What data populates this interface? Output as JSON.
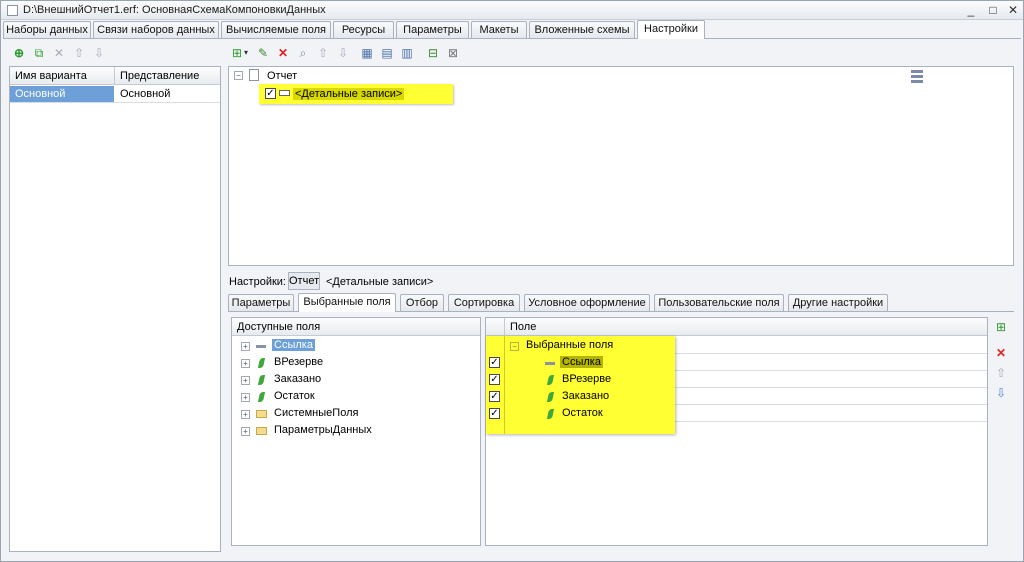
{
  "window": {
    "title": "D:\\ВнешнийОтчет1.erf: ОсновнаяСхемаКомпоновкиДанных",
    "minimize_glyph": "_",
    "maximize_glyph": "□",
    "close_glyph": "✕"
  },
  "top_tabs": [
    {
      "label": "Наборы данных"
    },
    {
      "label": "Связи наборов данных"
    },
    {
      "label": "Вычисляемые поля"
    },
    {
      "label": "Ресурсы"
    },
    {
      "label": "Параметры"
    },
    {
      "label": "Макеты"
    },
    {
      "label": "Вложенные схемы"
    },
    {
      "label": "Настройки"
    }
  ],
  "variants": {
    "columns": [
      "Имя варианта",
      "Представление"
    ],
    "rows": [
      [
        "Основной",
        "Основной"
      ]
    ]
  },
  "structure": {
    "root_label": "Отчет",
    "child_label": "<Детальные записи>"
  },
  "settings_bar": {
    "label": "Настройки:",
    "button": "Отчет",
    "value": "<Детальные записи>"
  },
  "settings_tabs": [
    {
      "label": "Параметры"
    },
    {
      "label": "Выбранные поля"
    },
    {
      "label": "Отбор"
    },
    {
      "label": "Сортировка"
    },
    {
      "label": "Условное оформление"
    },
    {
      "label": "Пользовательские поля"
    },
    {
      "label": "Другие настройки"
    }
  ],
  "available_fields": {
    "header": "Доступные поля",
    "items": [
      {
        "label": "Ссылка",
        "icon": "dash-icon"
      },
      {
        "label": "ВРезерве",
        "icon": "leaf-icon"
      },
      {
        "label": "Заказано",
        "icon": "leaf-icon"
      },
      {
        "label": "Остаток",
        "icon": "leaf-icon"
      },
      {
        "label": "СистемныеПоля",
        "icon": "folder-icon"
      },
      {
        "label": "ПараметрыДанных",
        "icon": "folder-icon"
      }
    ]
  },
  "selected_fields": {
    "header": "Поле",
    "group_label": "Выбранные поля",
    "items": [
      {
        "label": "Ссылка",
        "icon": "dash-icon",
        "checked": true
      },
      {
        "label": "ВРезерве",
        "icon": "leaf-icon",
        "checked": true
      },
      {
        "label": "Заказано",
        "icon": "leaf-icon",
        "checked": true
      },
      {
        "label": "Остаток",
        "icon": "leaf-icon",
        "checked": true
      }
    ]
  },
  "colors": {
    "highlight": "#ffff33",
    "selection": "#6d9fd8"
  }
}
